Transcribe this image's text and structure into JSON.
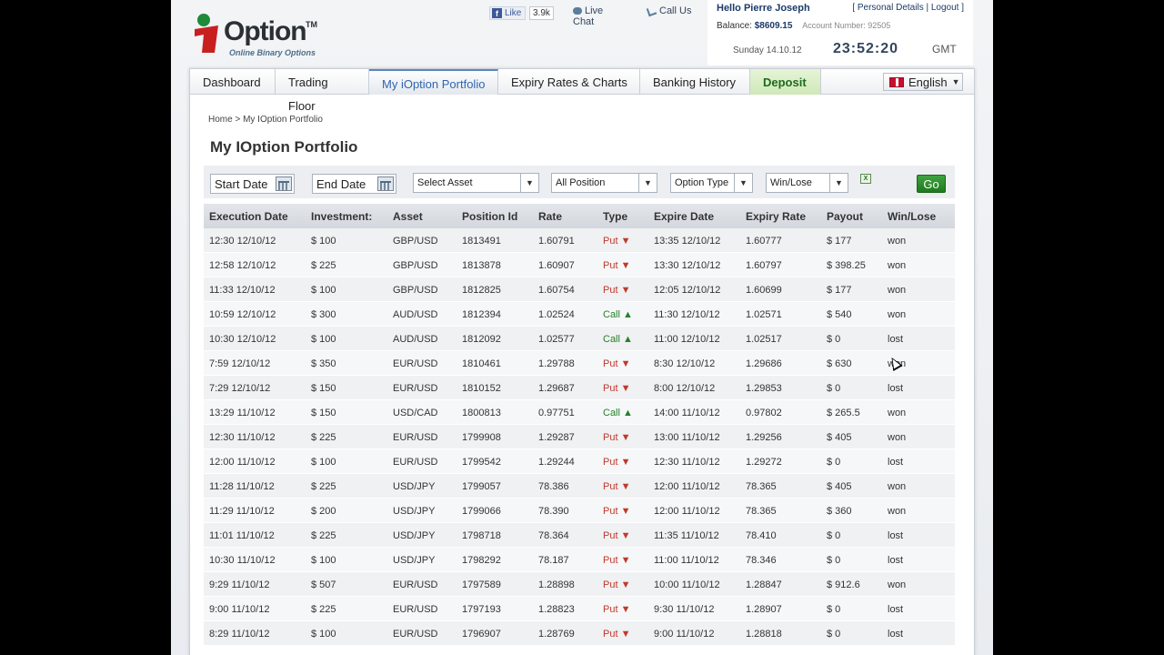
{
  "brand": {
    "logo_letter": "i",
    "logo_word": "Option",
    "logo_tm": "TM",
    "logo_sub": "Online Binary Options"
  },
  "social": {
    "like_label": "Like",
    "like_count": "3.9k"
  },
  "header": {
    "live_chat": "Live Chat",
    "call_us": "Call Us"
  },
  "account": {
    "hello": "Hello Pierre Joseph",
    "personal_details": "Personal Details",
    "logout": "Logout",
    "balance_label": "Balance:",
    "balance_value": "$8609.15",
    "account_number_label": "Account Number:",
    "account_number": "92505",
    "date": "Sunday 14.10.12",
    "time": "23:52:20",
    "timezone": "GMT"
  },
  "nav": {
    "tabs": [
      {
        "label": "Dashboard"
      },
      {
        "label": "Trading"
      },
      {
        "label": "My iOption Portfolio"
      },
      {
        "label": "Expiry Rates & Charts"
      },
      {
        "label": "Banking History"
      },
      {
        "label": "Deposit"
      }
    ],
    "trading_line2": "Floor",
    "language": "English"
  },
  "breadcrumb": "Home > My IOption Portfolio",
  "page_title": "My IOption Portfolio",
  "filters": {
    "start_date": "Start Date",
    "end_date": "End Date",
    "asset": "Select Asset",
    "position": "All Position",
    "option_type": "Option Type",
    "win_lose": "Win/Lose",
    "xls_icon_text": "X",
    "go": "Go"
  },
  "table": {
    "headers": [
      "Execution Date",
      "Investment:",
      "Asset",
      "Position Id",
      "Rate",
      "Type",
      "Expire Date",
      "Expiry Rate",
      "Payout",
      "Win/Lose"
    ],
    "rows": [
      [
        "12:30 12/10/12",
        "$ 100",
        "GBP/USD",
        "1813491",
        "1.60791",
        "Put ▼",
        "13:35 12/10/12",
        "1.60777",
        "$ 177",
        "won"
      ],
      [
        "12:58 12/10/12",
        "$ 225",
        "GBP/USD",
        "1813878",
        "1.60907",
        "Put ▼",
        "13:30 12/10/12",
        "1.60797",
        "$ 398.25",
        "won"
      ],
      [
        "11:33 12/10/12",
        "$ 100",
        "GBP/USD",
        "1812825",
        "1.60754",
        "Put ▼",
        "12:05 12/10/12",
        "1.60699",
        "$ 177",
        "won"
      ],
      [
        "10:59 12/10/12",
        "$ 300",
        "AUD/USD",
        "1812394",
        "1.02524",
        "Call ▲",
        "11:30 12/10/12",
        "1.02571",
        "$ 540",
        "won"
      ],
      [
        "10:30 12/10/12",
        "$ 100",
        "AUD/USD",
        "1812092",
        "1.02577",
        "Call ▲",
        "11:00 12/10/12",
        "1.02517",
        "$ 0",
        "lost"
      ],
      [
        "7:59 12/10/12",
        "$ 350",
        "EUR/USD",
        "1810461",
        "1.29788",
        "Put ▼",
        "8:30 12/10/12",
        "1.29686",
        "$ 630",
        "won"
      ],
      [
        "7:29 12/10/12",
        "$ 150",
        "EUR/USD",
        "1810152",
        "1.29687",
        "Put ▼",
        "8:00 12/10/12",
        "1.29853",
        "$ 0",
        "lost"
      ],
      [
        "13:29 11/10/12",
        "$ 150",
        "USD/CAD",
        "1800813",
        "0.97751",
        "Call ▲",
        "14:00 11/10/12",
        "0.97802",
        "$ 265.5",
        "won"
      ],
      [
        "12:30 11/10/12",
        "$ 225",
        "EUR/USD",
        "1799908",
        "1.29287",
        "Put ▼",
        "13:00 11/10/12",
        "1.29256",
        "$ 405",
        "won"
      ],
      [
        "12:00 11/10/12",
        "$ 100",
        "EUR/USD",
        "1799542",
        "1.29244",
        "Put ▼",
        "12:30 11/10/12",
        "1.29272",
        "$ 0",
        "lost"
      ],
      [
        "11:28 11/10/12",
        "$ 225",
        "USD/JPY",
        "1799057",
        "78.386",
        "Put ▼",
        "12:00 11/10/12",
        "78.365",
        "$ 405",
        "won"
      ],
      [
        "11:29 11/10/12",
        "$ 200",
        "USD/JPY",
        "1799066",
        "78.390",
        "Put ▼",
        "12:00 11/10/12",
        "78.365",
        "$ 360",
        "won"
      ],
      [
        "11:01 11/10/12",
        "$ 225",
        "USD/JPY",
        "1798718",
        "78.364",
        "Put ▼",
        "11:35 11/10/12",
        "78.410",
        "$ 0",
        "lost"
      ],
      [
        "10:30 11/10/12",
        "$ 100",
        "USD/JPY",
        "1798292",
        "78.187",
        "Put ▼",
        "11:00 11/10/12",
        "78.346",
        "$ 0",
        "lost"
      ],
      [
        "9:29 11/10/12",
        "$ 507",
        "EUR/USD",
        "1797589",
        "1.28898",
        "Put ▼",
        "10:00 11/10/12",
        "1.28847",
        "$ 912.6",
        "won"
      ],
      [
        "9:00 11/10/12",
        "$ 225",
        "EUR/USD",
        "1797193",
        "1.28823",
        "Put ▼",
        "9:30 11/10/12",
        "1.28907",
        "$ 0",
        "lost"
      ],
      [
        "8:29 11/10/12",
        "$ 100",
        "EUR/USD",
        "1796907",
        "1.28769",
        "Put ▼",
        "9:00 11/10/12",
        "1.28818",
        "$ 0",
        "lost"
      ]
    ]
  },
  "colors": {
    "put": "#c0392b",
    "call": "#27802b",
    "accent": "#2f66ad",
    "deposit": "#1e6b1e"
  }
}
